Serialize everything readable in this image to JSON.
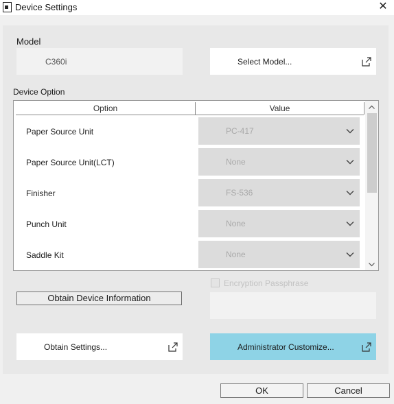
{
  "window": {
    "title": "Device Settings",
    "icon": "document-icon",
    "close_glyph": "✕"
  },
  "model": {
    "label": "Model",
    "value": "C360i",
    "select_button": "Select Model..."
  },
  "device_option": {
    "label": "Device Option",
    "columns": [
      "Option",
      "Value"
    ],
    "rows": [
      {
        "option": "Paper Source Unit",
        "value": "PC-417"
      },
      {
        "option": "Paper Source Unit(LCT)",
        "value": "None"
      },
      {
        "option": "Finisher",
        "value": "FS-536"
      },
      {
        "option": "Punch Unit",
        "value": "None"
      },
      {
        "option": "Saddle Kit",
        "value": "None"
      }
    ]
  },
  "obtain_device_info": "Obtain Device Information",
  "encryption": {
    "label": "Encryption Passphrase",
    "checked": false,
    "value": ""
  },
  "obtain_settings": "Obtain Settings...",
  "admin_customize": "Administrator Customize...",
  "dialog_buttons": {
    "ok": "OK",
    "cancel": "Cancel"
  },
  "colors": {
    "accent": "#8ed3e6",
    "panel": "#e8e8e8",
    "disabled_text": "#a9a9a9"
  }
}
